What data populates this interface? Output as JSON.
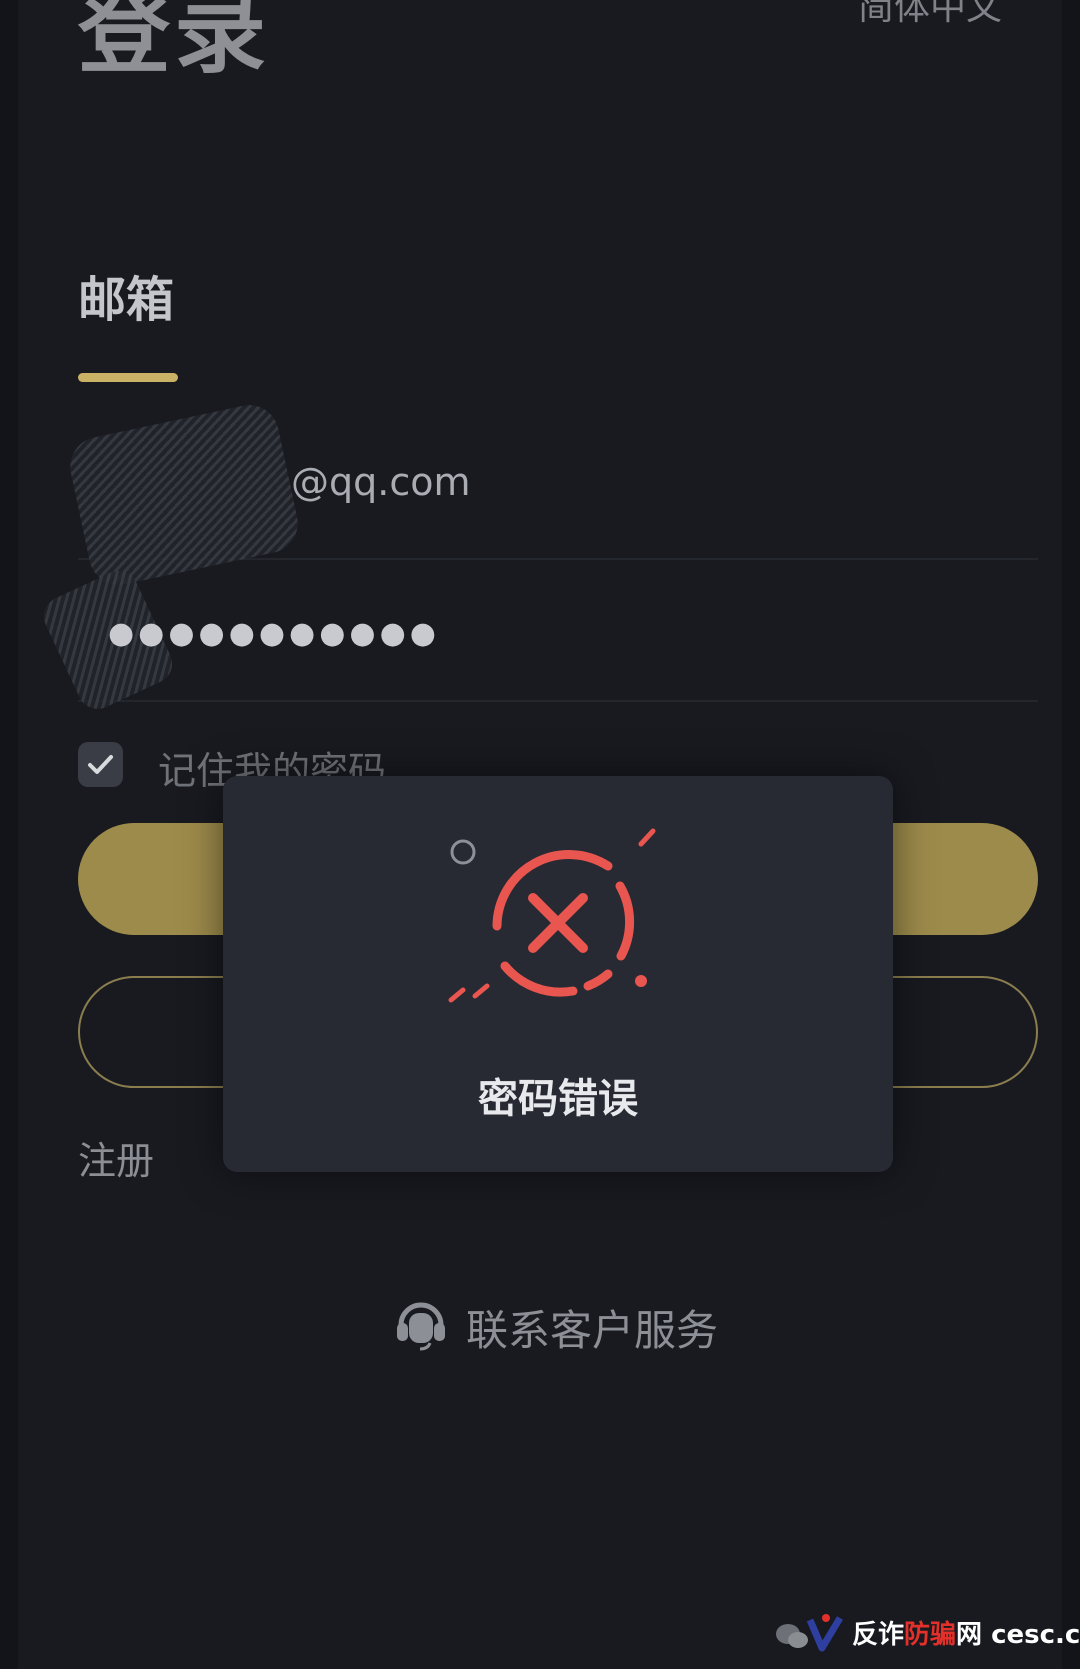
{
  "header": {
    "title": "登录",
    "language": "简体中文"
  },
  "login_tabs": {
    "active": "邮箱"
  },
  "form": {
    "email_value": "@qq.com",
    "password_masked": "●●●●●●●●●●●",
    "remember_label": "记住我的密码",
    "remember_checked": true
  },
  "links": {
    "register": "注册",
    "contact_support": "联系客户服务"
  },
  "dialog": {
    "message": "密码错误",
    "icon": "error-x-icon"
  },
  "watermark": {
    "part1": "反诈",
    "part2": "防骗",
    "part3": "网",
    "domain": "cesc.cc"
  },
  "colors": {
    "accent_gold": "#c9b165",
    "error_red": "#e8564f",
    "background": "#181a20"
  }
}
